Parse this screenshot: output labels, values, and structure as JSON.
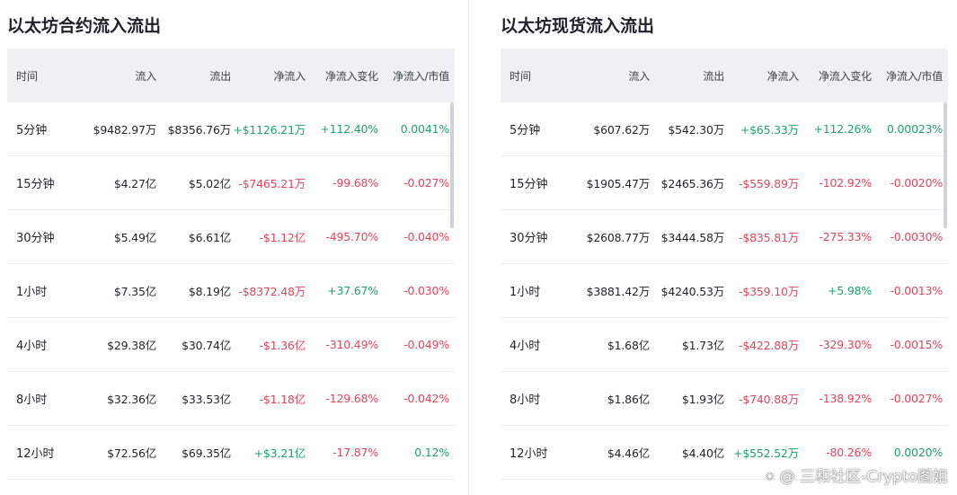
{
  "headers": [
    "时间",
    "流入",
    "流出",
    "净流入",
    "净流入变化",
    "净流入/市值"
  ],
  "colors": {
    "positive": "#1fa36b",
    "negative": "#e0465b",
    "header_bg": "#eef0f3"
  },
  "futures": {
    "title": "以太坊合约流入流出",
    "rows": [
      {
        "time": "5分钟",
        "inflow": "$9482.97万",
        "outflow": "$8356.76万",
        "net": "+$1126.21万",
        "change": "+112.40%",
        "ratio": "0.0041%",
        "net_sign": "pos",
        "change_sign": "pos",
        "ratio_sign": "pos"
      },
      {
        "time": "15分钟",
        "inflow": "$4.27亿",
        "outflow": "$5.02亿",
        "net": "-$7465.21万",
        "change": "-99.68%",
        "ratio": "-0.027%",
        "net_sign": "neg",
        "change_sign": "neg",
        "ratio_sign": "neg"
      },
      {
        "time": "30分钟",
        "inflow": "$5.49亿",
        "outflow": "$6.61亿",
        "net": "-$1.12亿",
        "change": "-495.70%",
        "ratio": "-0.040%",
        "net_sign": "neg",
        "change_sign": "neg",
        "ratio_sign": "neg"
      },
      {
        "time": "1小时",
        "inflow": "$7.35亿",
        "outflow": "$8.19亿",
        "net": "-$8372.48万",
        "change": "+37.67%",
        "ratio": "-0.030%",
        "net_sign": "neg",
        "change_sign": "pos",
        "ratio_sign": "neg"
      },
      {
        "time": "4小时",
        "inflow": "$29.38亿",
        "outflow": "$30.74亿",
        "net": "-$1.36亿",
        "change": "-310.49%",
        "ratio": "-0.049%",
        "net_sign": "neg",
        "change_sign": "neg",
        "ratio_sign": "neg"
      },
      {
        "time": "8小时",
        "inflow": "$32.36亿",
        "outflow": "$33.53亿",
        "net": "-$1.18亿",
        "change": "-129.68%",
        "ratio": "-0.042%",
        "net_sign": "neg",
        "change_sign": "neg",
        "ratio_sign": "neg"
      },
      {
        "time": "12小时",
        "inflow": "$72.56亿",
        "outflow": "$69.35亿",
        "net": "+$3.21亿",
        "change": "-17.87%",
        "ratio": "0.12%",
        "net_sign": "pos",
        "change_sign": "neg",
        "ratio_sign": "pos"
      }
    ]
  },
  "spot": {
    "title": "以太坊现货流入流出",
    "rows": [
      {
        "time": "5分钟",
        "inflow": "$607.62万",
        "outflow": "$542.30万",
        "net": "+$65.33万",
        "change": "+112.26%",
        "ratio": "0.00023%",
        "net_sign": "pos",
        "change_sign": "pos",
        "ratio_sign": "pos"
      },
      {
        "time": "15分钟",
        "inflow": "$1905.47万",
        "outflow": "$2465.36万",
        "net": "-$559.89万",
        "change": "-102.92%",
        "ratio": "-0.0020%",
        "net_sign": "neg",
        "change_sign": "neg",
        "ratio_sign": "neg"
      },
      {
        "time": "30分钟",
        "inflow": "$2608.77万",
        "outflow": "$3444.58万",
        "net": "-$835.81万",
        "change": "-275.33%",
        "ratio": "-0.0030%",
        "net_sign": "neg",
        "change_sign": "neg",
        "ratio_sign": "neg"
      },
      {
        "time": "1小时",
        "inflow": "$3881.42万",
        "outflow": "$4240.53万",
        "net": "-$359.10万",
        "change": "+5.98%",
        "ratio": "-0.0013%",
        "net_sign": "neg",
        "change_sign": "pos",
        "ratio_sign": "neg"
      },
      {
        "time": "4小时",
        "inflow": "$1.68亿",
        "outflow": "$1.73亿",
        "net": "-$422.88万",
        "change": "-329.30%",
        "ratio": "-0.0015%",
        "net_sign": "neg",
        "change_sign": "neg",
        "ratio_sign": "neg"
      },
      {
        "time": "8小时",
        "inflow": "$1.86亿",
        "outflow": "$1.93亿",
        "net": "-$740.88万",
        "change": "-138.92%",
        "ratio": "-0.0027%",
        "net_sign": "neg",
        "change_sign": "neg",
        "ratio_sign": "neg"
      },
      {
        "time": "12小时",
        "inflow": "$4.46亿",
        "outflow": "$4.40亿",
        "net": "+$552.52万",
        "change": "-80.26%",
        "ratio": "0.0020%",
        "net_sign": "pos",
        "change_sign": "neg",
        "ratio_sign": "pos"
      }
    ]
  },
  "watermark": {
    "icon": "weibo-icon",
    "text": "@ 三和社区-Crypto图姐"
  }
}
